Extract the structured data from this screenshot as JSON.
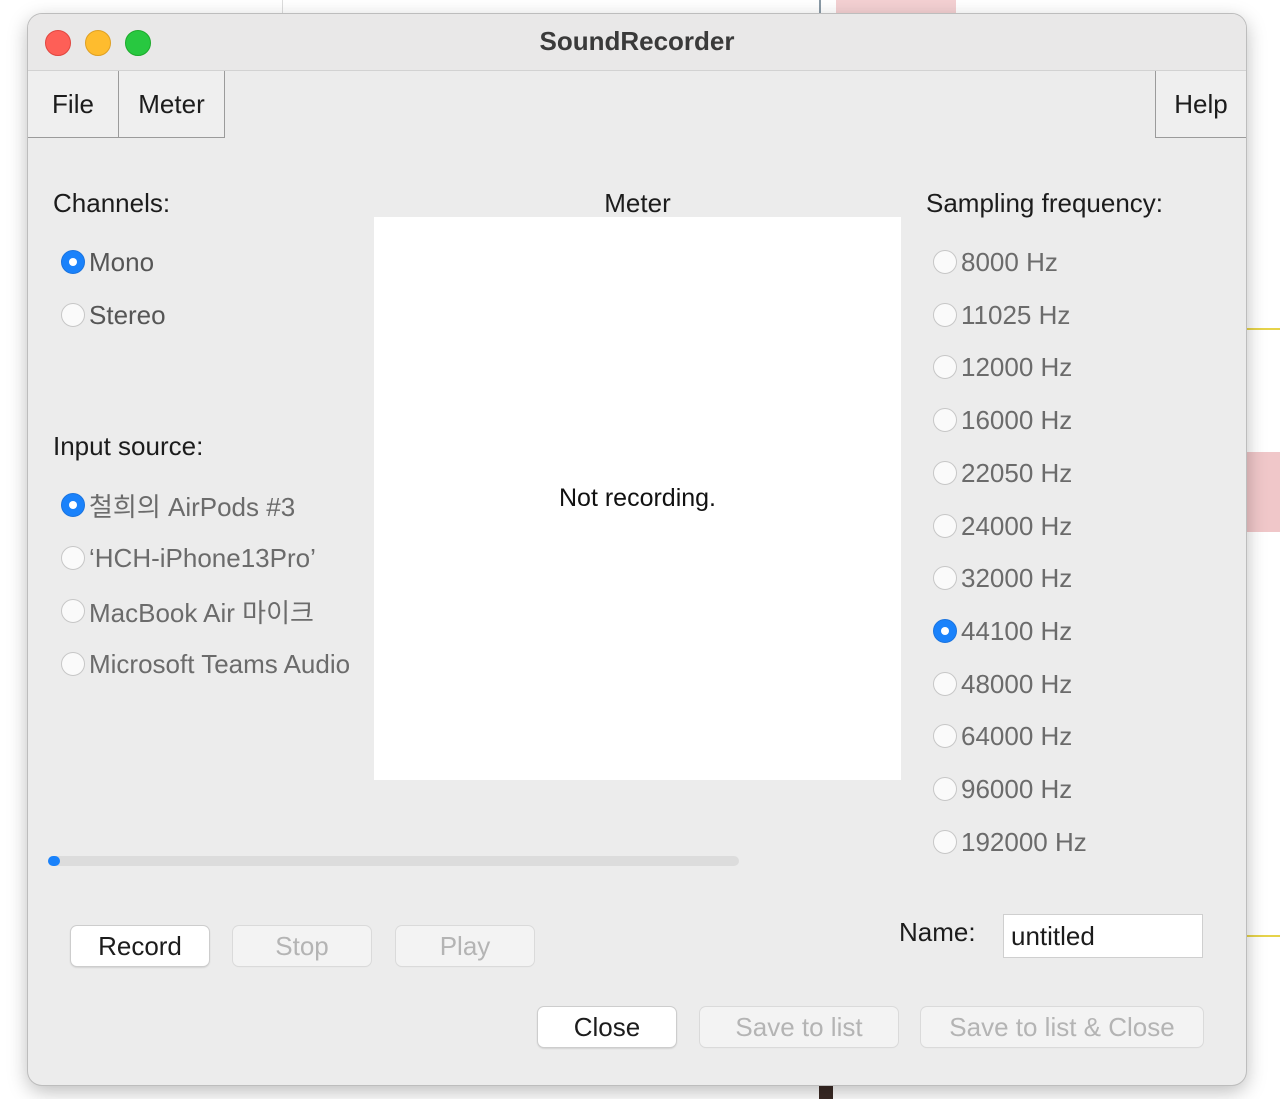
{
  "window": {
    "title": "SoundRecorder"
  },
  "menubar": {
    "file": "File",
    "meter": "Meter",
    "help": "Help"
  },
  "channels": {
    "label": "Channels:",
    "options": [
      {
        "label": "Mono",
        "selected": true
      },
      {
        "label": "Stereo",
        "selected": false
      }
    ]
  },
  "input_source": {
    "label": "Input source:",
    "options": [
      {
        "label": "철희의 AirPods #3",
        "selected": true
      },
      {
        "label": "‘HCH-iPhone13Pro’",
        "selected": false
      },
      {
        "label": "MacBook Air 마이크",
        "selected": false
      },
      {
        "label": "Microsoft Teams Audio",
        "selected": false
      }
    ]
  },
  "meter": {
    "heading": "Meter",
    "status": "Not recording."
  },
  "sampling": {
    "label": "Sampling frequency:",
    "options": [
      {
        "label": "8000 Hz",
        "selected": false
      },
      {
        "label": "11025 Hz",
        "selected": false
      },
      {
        "label": "12000 Hz",
        "selected": false
      },
      {
        "label": "16000 Hz",
        "selected": false
      },
      {
        "label": "22050 Hz",
        "selected": false
      },
      {
        "label": "24000 Hz",
        "selected": false
      },
      {
        "label": "32000 Hz",
        "selected": false
      },
      {
        "label": "44100 Hz",
        "selected": true
      },
      {
        "label": "48000 Hz",
        "selected": false
      },
      {
        "label": "64000 Hz",
        "selected": false
      },
      {
        "label": "96000 Hz",
        "selected": false
      },
      {
        "label": "192000 Hz",
        "selected": false
      }
    ]
  },
  "progress": {
    "fraction": 0.0
  },
  "controls": {
    "record": "Record",
    "stop": "Stop",
    "play": "Play"
  },
  "name": {
    "label": "Name:",
    "value": "untitled"
  },
  "footer": {
    "close": "Close",
    "save_to_list": "Save to list",
    "save_to_list_close": "Save to list & Close"
  },
  "colors": {
    "accent": "#1a82fb",
    "window_bg": "#ececec"
  }
}
